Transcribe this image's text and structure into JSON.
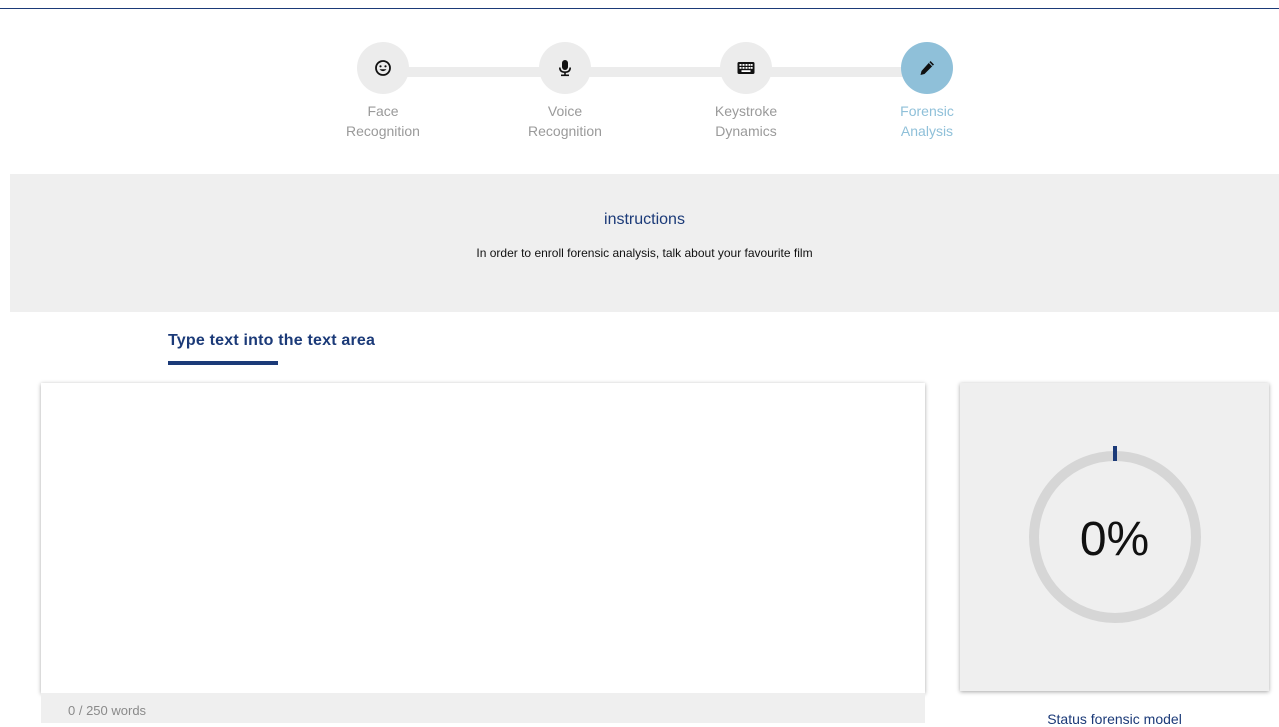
{
  "stepper": {
    "steps": [
      {
        "line1": "Face",
        "line2": "Recognition",
        "icon": "smile-icon",
        "active": false
      },
      {
        "line1": "Voice",
        "line2": "Recognition",
        "icon": "microphone-icon",
        "active": false
      },
      {
        "line1": "Keystroke",
        "line2": "Dynamics",
        "icon": "keyboard-icon",
        "active": false
      },
      {
        "line1": "Forensic",
        "line2": "Analysis",
        "icon": "pencil-icon",
        "active": true
      }
    ]
  },
  "instructions": {
    "title": "instructions",
    "text": "In order to enroll forensic analysis, talk about your favourite film"
  },
  "editor": {
    "heading": "Type text into the text area",
    "value": "",
    "word_count": "0 / 250 words"
  },
  "progress": {
    "value_text": "0%",
    "percent": 0,
    "status_label": "Status forensic model"
  },
  "colors": {
    "brand": "#1b3a78",
    "active_step": "#8fc0d9",
    "inactive_step": "#ececec",
    "panel_bg": "#efefef",
    "ring": "#d6d6d6"
  }
}
